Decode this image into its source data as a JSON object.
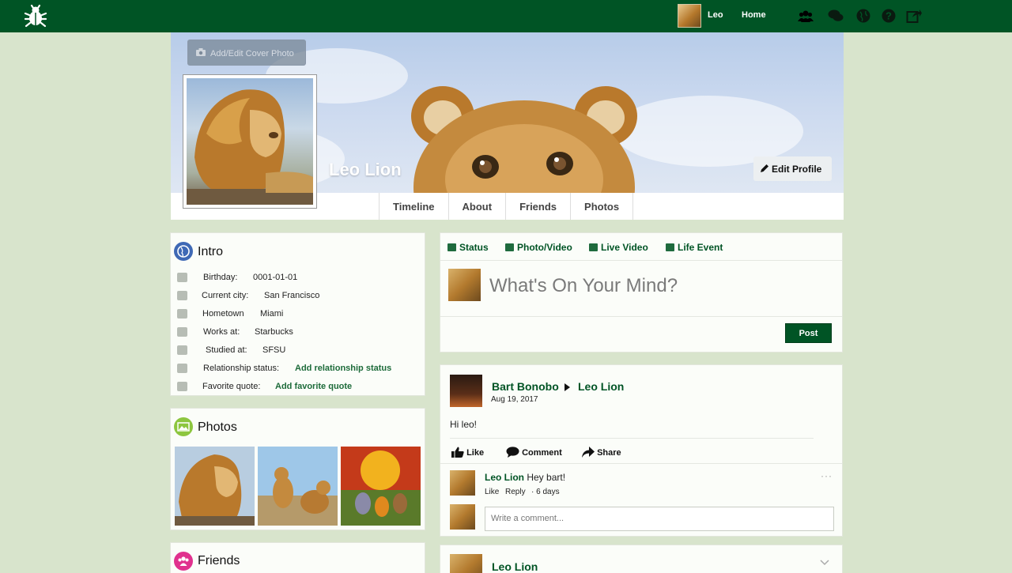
{
  "nav": {
    "user_name": "Leo",
    "home_label": "Home",
    "icons": [
      "bug-logo-icon",
      "friends-icon",
      "messages-icon",
      "globe-icon",
      "help-icon",
      "logout-icon"
    ]
  },
  "profile": {
    "cover_button_label": "Add/Edit Cover Photo",
    "name": "Leo Lion",
    "edit_profile_label": "Edit Profile",
    "tabs": [
      "Timeline",
      "About",
      "Friends",
      "Photos"
    ]
  },
  "intro": {
    "title": "Intro",
    "rows": [
      {
        "label": "Birthday:",
        "value": "0001-01-01",
        "icon": "cake-icon"
      },
      {
        "label": "Current city:",
        "value": "San Francisco",
        "icon": "building-icon"
      },
      {
        "label": "Hometown",
        "value": "Miami",
        "icon": "home-icon"
      },
      {
        "label": "Works at:",
        "value": "Starbucks",
        "icon": "briefcase-icon"
      },
      {
        "label": "Studied at:",
        "value": "SFSU",
        "icon": "graduation-cap-icon"
      },
      {
        "label": "Relationship status:",
        "value": "Add relationship status",
        "icon": "heart-icon"
      },
      {
        "label": "Favorite quote:",
        "value": "Add favorite quote",
        "icon": "book-icon"
      }
    ]
  },
  "photos": {
    "title": "Photos"
  },
  "friends": {
    "title": "Friends"
  },
  "composer": {
    "tabs": [
      "Status",
      "Photo/Video",
      "Live Video",
      "Life Event"
    ],
    "prompt": "What's On Your Mind?",
    "post_label": "Post"
  },
  "post1": {
    "author": "Bart Bonobo",
    "target": "Leo Lion",
    "date": "Aug 19, 2017",
    "body": "Hi leo!",
    "actions": [
      "Like",
      "Comment",
      "Share"
    ],
    "comment": {
      "author": "Leo Lion",
      "text": "Hey bart!",
      "like": "Like",
      "reply": "Reply",
      "age": "· 6 days"
    },
    "comment_placeholder": "Write a comment..."
  },
  "post2": {
    "author": "Leo Lion"
  },
  "colors": {
    "nav_green": "#005425",
    "page_bg": "#d8e4cc",
    "link_green": "#1d6b3a"
  }
}
